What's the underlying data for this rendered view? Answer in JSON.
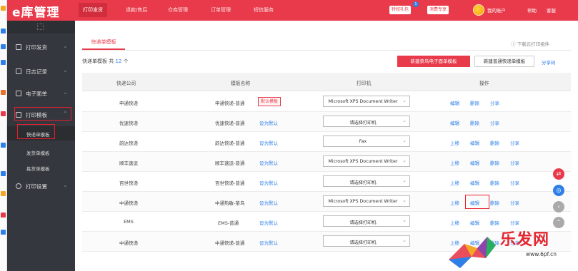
{
  "app": {
    "logo_text": "e库管理"
  },
  "topnav": {
    "items": [
      {
        "label": "打印发货",
        "active": true
      },
      {
        "label": "退款/售后"
      },
      {
        "label": "仓库管理"
      },
      {
        "label": "订单管理"
      },
      {
        "label": "短信服务"
      }
    ],
    "pills": [
      {
        "label": "特权礼包",
        "badge": "1"
      },
      {
        "label": "消费专享"
      }
    ],
    "account_label": "我的账户",
    "help_label": "帮助",
    "logout_label": "客服"
  },
  "sidebar": {
    "items": [
      {
        "label": "打印发货",
        "icon": "print-icon"
      },
      {
        "label": "日志记录",
        "icon": "log-icon"
      },
      {
        "label": "电子面单",
        "icon": "waybill-icon"
      },
      {
        "label": "打印模板",
        "icon": "template-icon",
        "expanded": true
      },
      {
        "label": "打印设置",
        "icon": "gear-icon"
      }
    ],
    "sub_items": [
      {
        "label": "快递单模板",
        "active": true
      },
      {
        "label": "发货单模板"
      },
      {
        "label": "拣货单模板"
      }
    ]
  },
  "main": {
    "tab_label": "快递单模板",
    "help_link": "下载云打印组件",
    "count_prefix": "快递单模板 共",
    "count_value": "12",
    "count_suffix": "个",
    "new_electronic_button": "新建菜鸟电子面单模板",
    "new_normal_button": "新建普通快递单模板",
    "share_link": "分享码",
    "columns": [
      "快递公司",
      "模板名称",
      "打印机",
      "操作"
    ],
    "rows": [
      {
        "company": "申通快递",
        "template": "申通快递-普通",
        "tag": "默认模板",
        "printer": "Microsoft XPS Document Writer",
        "ops": [
          "编辑",
          "删除",
          "分享"
        ]
      },
      {
        "company": "优速快递",
        "template": "优速快递-普通",
        "set_default": "设为默认",
        "printer": "请选择打印机",
        "ops": [
          "编辑",
          "删除",
          "分享"
        ]
      },
      {
        "company": "韵达快递",
        "template": "韵达快递-普通",
        "set_default": "设为默认",
        "printer": "Fax",
        "ops": [
          "上移",
          "编辑",
          "删除",
          "分享"
        ]
      },
      {
        "company": "顺丰速运",
        "template": "顺丰速运-普通",
        "set_default": "设为默认",
        "printer": "Microsoft XPS Document Writer",
        "ops": [
          "上移",
          "编辑",
          "删除",
          "分享"
        ]
      },
      {
        "company": "百世快递",
        "template": "百世快递-普通",
        "set_default": "设为默认",
        "printer": "请选择打印机",
        "ops": [
          "上移",
          "编辑",
          "删除",
          "分享"
        ]
      },
      {
        "company": "中通快递",
        "template": "中通热敏-菜鸟",
        "set_default": "设为默认",
        "printer": "Microsoft XPS Document Writer",
        "ops": [
          "上移",
          "编辑",
          "删除",
          "分享"
        ]
      },
      {
        "company": "EMS",
        "template": "EMS-普通",
        "set_default": "设为默认",
        "printer": "请选择打印机",
        "ops": [
          "上移",
          "编辑",
          "删除",
          "分享"
        ]
      },
      {
        "company": "中通快递",
        "template": "中通快递-普通",
        "set_default": "设为默认",
        "printer": "请选择打印机",
        "ops": [
          "上移",
          "编辑",
          "删除",
          "分享"
        ]
      }
    ]
  },
  "watermark": {
    "text": "乐发网",
    "url": "www.6pf.cn"
  },
  "colors": {
    "brand": "#e83a4a",
    "sidebar": "#34373d",
    "link": "#2f7fe8"
  }
}
